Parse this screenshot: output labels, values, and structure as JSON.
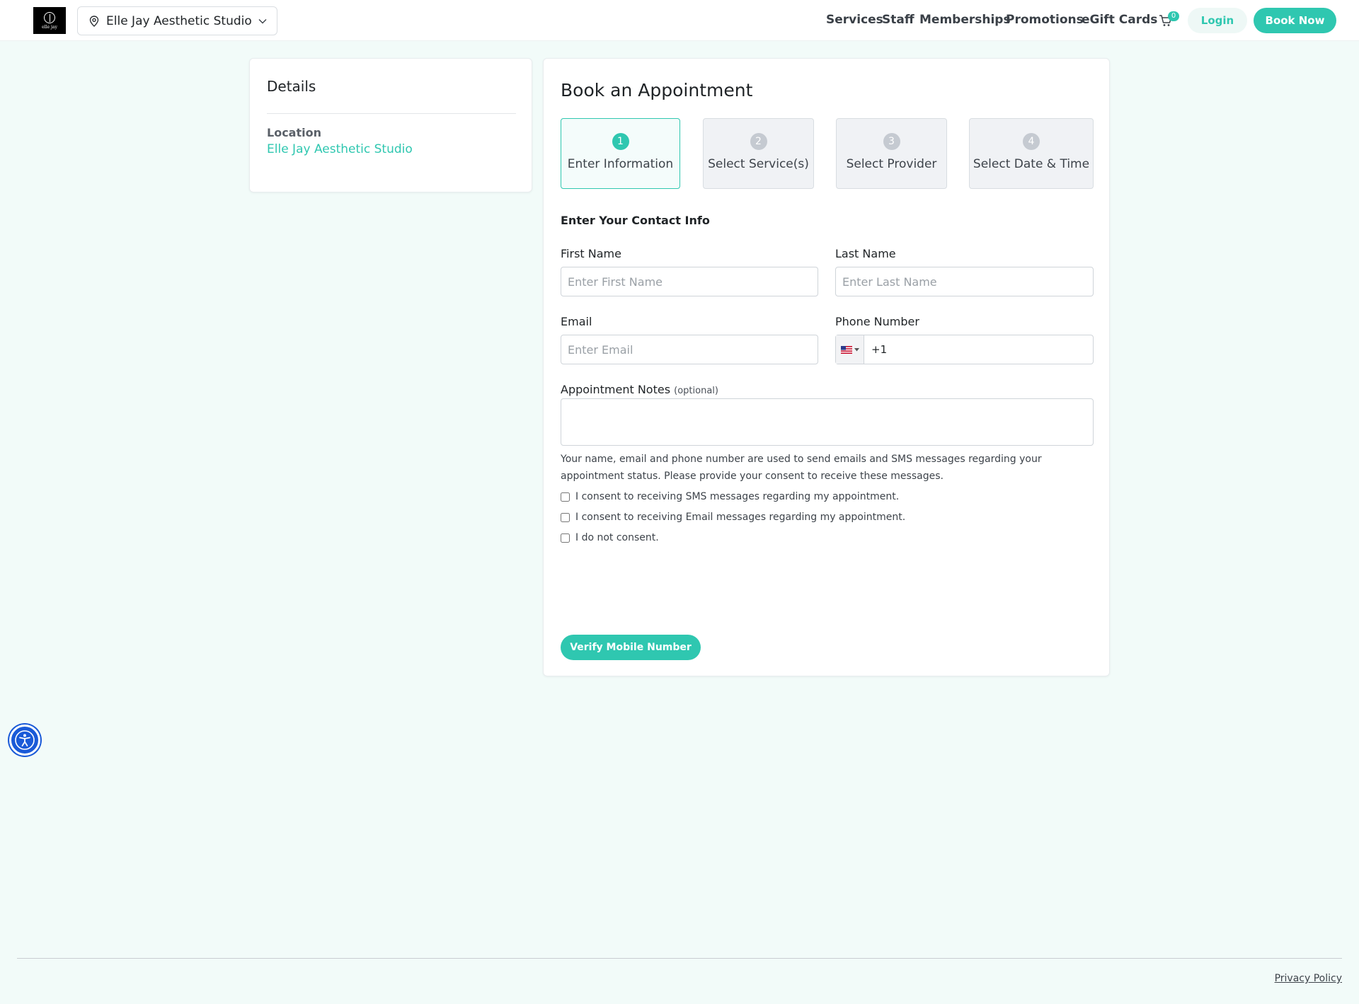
{
  "header": {
    "logo_text": "elle jay",
    "location_select": "Elle Jay Aesthetic Studio",
    "nav": {
      "services": "Services",
      "staff": "Staff",
      "memberships": "Memberships",
      "promotions": "Promotions",
      "egift": "eGift Cards"
    },
    "cart_count": "0",
    "login": "Login",
    "book_now": "Book Now"
  },
  "details": {
    "title": "Details",
    "location_label": "Location",
    "location_value": "Elle Jay Aesthetic Studio"
  },
  "booking": {
    "title": "Book an Appointment",
    "steps": [
      {
        "num": "1",
        "label": "Enter Information"
      },
      {
        "num": "2",
        "label": "Select Service(s)"
      },
      {
        "num": "3",
        "label": "Select Provider"
      },
      {
        "num": "4",
        "label": "Select Date & Time"
      }
    ],
    "section_title": "Enter Your Contact Info",
    "first_name": {
      "label": "First Name",
      "placeholder": "Enter First Name",
      "value": ""
    },
    "last_name": {
      "label": "Last Name",
      "placeholder": "Enter Last Name",
      "value": ""
    },
    "email": {
      "label": "Email",
      "placeholder": "Enter Email",
      "value": ""
    },
    "phone": {
      "label": "Phone Number",
      "value": "+1",
      "country": "US"
    },
    "notes": {
      "label": "Appointment Notes",
      "optional": "(optional)",
      "value": ""
    },
    "notice": "Your name, email and phone number are used to send emails and SMS messages regarding your appointment status. Please provide your consent to receive these messages.",
    "consents": [
      "I consent to receiving SMS messages regarding my appointment.",
      "I consent to receiving Email messages regarding my appointment.",
      "I do not consent."
    ],
    "verify_button": "Verify Mobile Number"
  },
  "footer": {
    "privacy": "Privacy Policy"
  },
  "colors": {
    "accent": "#2fc7b0",
    "page_bg": "#f2fbf9",
    "a11y_button": "#1a5ad8"
  },
  "icons": [
    "map-pin-icon",
    "chevron-down-icon",
    "cart-icon",
    "us-flag-icon",
    "accessibility-icon"
  ]
}
